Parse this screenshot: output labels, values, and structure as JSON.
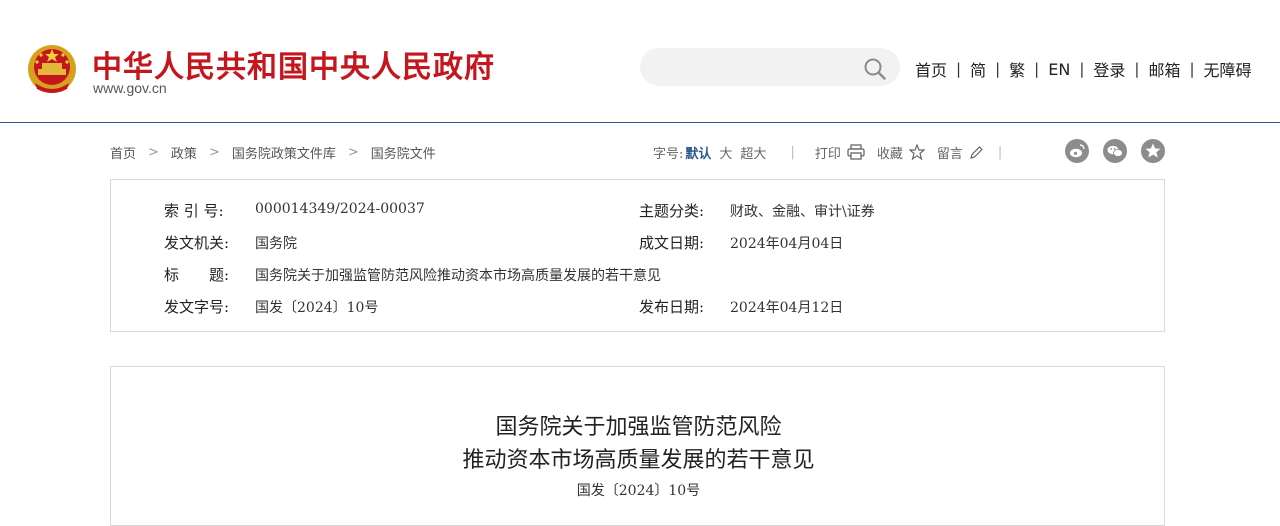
{
  "header": {
    "site_title": "中华人民共和国中央人民政府",
    "site_url": "www.gov.cn",
    "search_placeholder": "",
    "nav": [
      "首页",
      "简",
      "繁",
      "EN",
      "登录",
      "邮箱",
      "无障碍"
    ],
    "nav_separator": "|",
    "brand_color": "#c4161c"
  },
  "breadcrumb": {
    "items": [
      "首页",
      "政策",
      "国务院政策文件库",
      "国务院文件"
    ],
    "separator": ">"
  },
  "tools": {
    "font_size_label": "字号:",
    "font_default": "默认",
    "font_large": "大",
    "font_xlarge": "超大",
    "divider": "|",
    "print": "打印",
    "favorite": "收藏",
    "comment": "留言",
    "share_icons": [
      "weibo-icon",
      "wechat-icon",
      "qzone-icon"
    ]
  },
  "info": {
    "index_label": "索 引 号:",
    "index_value": "000014349/2024-00037",
    "topic_label": "主题分类:",
    "topic_value": "财政、金融、审计\\证券",
    "issuer_label": "发文机关:",
    "issuer_value": "国务院",
    "created_label": "成文日期:",
    "created_value": "2024年04月04日",
    "title_label": "标　　题:",
    "title_value": "国务院关于加强监管防范风险推动资本市场高质量发展的若干意见",
    "docno_label": "发文字号:",
    "docno_value": "国发〔2024〕10号",
    "published_label": "发布日期:",
    "published_value": "2024年04月12日"
  },
  "article": {
    "title_line1": "国务院关于加强监管防范风险",
    "title_line2": "推动资本市场高质量发展的若干意见",
    "doc_number": "国发〔2024〕10号"
  }
}
